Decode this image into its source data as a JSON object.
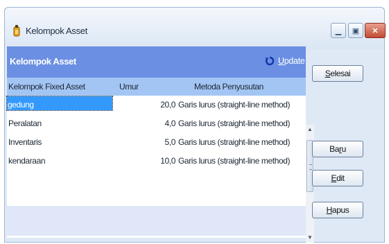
{
  "window": {
    "title": "Kelompok Asset"
  },
  "panel": {
    "title": "Kelompok Asset",
    "update_label": "Update",
    "update_accel": "U",
    "update_rest": "pdate"
  },
  "columns": [
    "Kelompok Fixed Asset",
    "Umur",
    "Metoda Penyusutan"
  ],
  "rows": [
    {
      "name": "gedung",
      "umur": "20,0",
      "method": "Garis lurus (straight-line method)",
      "selected": true
    },
    {
      "name": "Peralatan",
      "umur": "4,0",
      "method": "Garis lurus (straight-line method)",
      "selected": false
    },
    {
      "name": "Inventaris",
      "umur": "5,0",
      "method": "Garis lurus (straight-line method)",
      "selected": false
    },
    {
      "name": "kendaraan",
      "umur": "10,0",
      "method": "Garis lurus (straight-line method)",
      "selected": false
    }
  ],
  "buttons": {
    "selesai": {
      "accel": "S",
      "rest": "elesai"
    },
    "baru": {
      "pre": "Ba",
      "accel": "r",
      "rest": "u"
    },
    "edit": {
      "accel": "E",
      "rest": "dit"
    },
    "hapus": {
      "accel": "H",
      "rest": "apus"
    }
  },
  "colors": {
    "header_blue": "#6b8fe2",
    "column_blue": "#a3c5f4",
    "selection": "#3399ff"
  }
}
